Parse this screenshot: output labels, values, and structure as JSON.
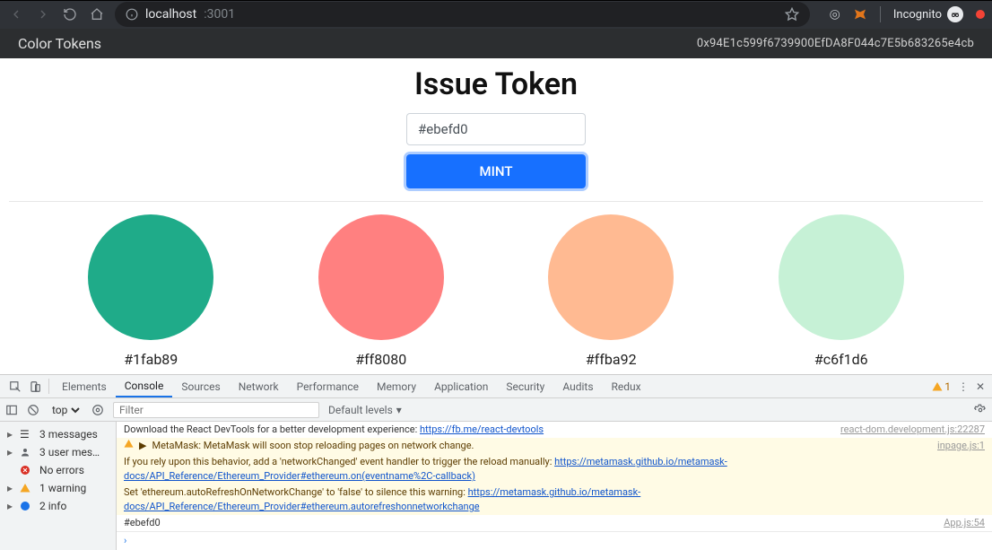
{
  "browser": {
    "url_prefix": "localhost",
    "url_suffix": ":3001",
    "incognito_label": "Incognito"
  },
  "app": {
    "title": "Color Tokens",
    "wallet_address": "0x94E1c599f6739900EfDA8F044c7E5b683265e4cb"
  },
  "issue": {
    "heading": "Issue Token",
    "input_value": "#ebefd0",
    "mint_label": "MINT"
  },
  "tokens": [
    {
      "color": "#1fab89",
      "label": "#1fab89"
    },
    {
      "color": "#ff8080",
      "label": "#ff8080"
    },
    {
      "color": "#ffba92",
      "label": "#ffba92"
    },
    {
      "color": "#c6f1d6",
      "label": "#c6f1d6"
    }
  ],
  "devtools": {
    "tabs": [
      "Elements",
      "Console",
      "Sources",
      "Network",
      "Performance",
      "Memory",
      "Application",
      "Security",
      "Audits",
      "Redux"
    ],
    "active_tab": "Console",
    "warn_count": "1",
    "context_label": "top",
    "filter_placeholder": "Filter",
    "levels_label": "Default levels",
    "sidebar": {
      "messages": "3 messages",
      "user": "3 user mes…",
      "errors": "No errors",
      "warnings": "1 warning",
      "info": "2 info"
    },
    "rows": [
      {
        "type": "log",
        "html": "Download the React DevTools for a better development experience: <a>https://fb.me/react-devtools</a>",
        "src": "react-dom.development.js:22287"
      },
      {
        "type": "warn",
        "html": "<span class='c-icon'>▶</span>MetaMask: MetaMask will soon stop reloading pages on network change.",
        "src": "inpage.js:1"
      },
      {
        "type": "warn",
        "html": "If you rely upon this behavior, add a 'networkChanged' event handler to trigger the reload manually: <a>https://metamask.github.io/metamask-docs/API_Reference/Ethereum_Provider#ethereum.on(eventname%2C-callback)</a>",
        "src": ""
      },
      {
        "type": "warn",
        "html": "Set 'ethereum.autoRefreshOnNetworkChange' to 'false' to silence this warning: <a>https://metamask.github.io/metamask-docs/API_Reference/Ethereum_Provider#ethereum.autorefreshonnetworkchange</a>",
        "src": ""
      },
      {
        "type": "log",
        "html": "#ebefd0",
        "src": "App.js:54"
      }
    ]
  }
}
